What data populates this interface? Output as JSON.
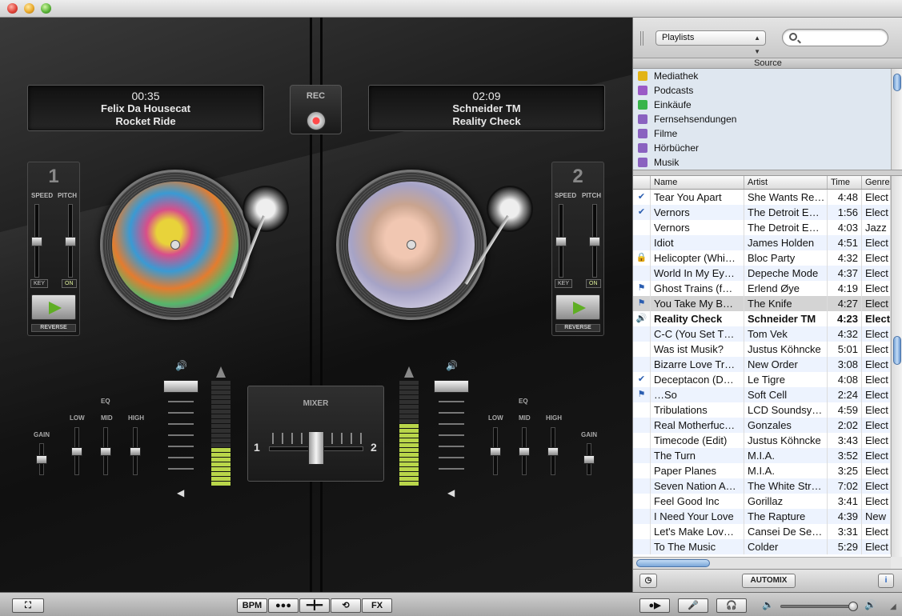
{
  "deck_left": {
    "time": "00:35",
    "artist": "Felix Da Housecat",
    "song": "Rocket Ride",
    "number": "1"
  },
  "deck_right": {
    "time": "02:09",
    "artist": "Schneider TM",
    "song": "Reality Check",
    "number": "2"
  },
  "rec_label": "REC",
  "deck_controls": {
    "speed": "SPEED",
    "pitch": "PITCH",
    "key": "KEY",
    "on": "ON",
    "reverse": "REVERSE"
  },
  "eq": {
    "title": "EQ",
    "low": "LOW",
    "mid": "MID",
    "high": "HIGH",
    "gain": "GAIN"
  },
  "mixer": {
    "label": "MIXER",
    "left": "1",
    "right": "2"
  },
  "sidebar": {
    "playlist_select": "Playlists",
    "search_placeholder": "",
    "source_header": "Source",
    "sources": [
      {
        "label": "Mediathek",
        "icon": "music-library-icon",
        "color": "#e2b418"
      },
      {
        "label": "Podcasts",
        "icon": "podcast-icon",
        "color": "#9b59c6"
      },
      {
        "label": "Einkäufe",
        "icon": "store-icon",
        "color": "#38b44a"
      },
      {
        "label": "Fernsehsendungen",
        "icon": "smart-playlist-icon",
        "color": "#8a62c0"
      },
      {
        "label": "Filme",
        "icon": "smart-playlist-icon",
        "color": "#8a62c0"
      },
      {
        "label": "Hörbücher",
        "icon": "smart-playlist-icon",
        "color": "#8a62c0"
      },
      {
        "label": "Musik",
        "icon": "smart-playlist-icon",
        "color": "#8a62c0"
      }
    ]
  },
  "tracklist": {
    "columns": [
      "Name",
      "Artist",
      "Time",
      "Genre"
    ],
    "rows": [
      {
        "mark": "✔",
        "name": "Tear You Apart",
        "artist": "She Wants Re…",
        "time": "4:48",
        "genre": "Elect"
      },
      {
        "mark": "✔",
        "name": "Vernors",
        "artist": "The Detroit E…",
        "time": "1:56",
        "genre": "Elect"
      },
      {
        "mark": "",
        "name": "Vernors",
        "artist": "The Detroit E…",
        "time": "4:03",
        "genre": "Jazz"
      },
      {
        "mark": "",
        "name": "Idiot",
        "artist": "James Holden",
        "time": "4:51",
        "genre": "Elect"
      },
      {
        "mark": "🔒",
        "name": "Helicopter (Whi…",
        "artist": "Bloc Party",
        "time": "4:32",
        "genre": "Elect"
      },
      {
        "mark": "",
        "name": "World In My Ey…",
        "artist": "Depeche Mode",
        "time": "4:37",
        "genre": "Elect"
      },
      {
        "mark": "⚑",
        "name": "Ghost Trains (f…",
        "artist": "Erlend Øye",
        "time": "4:19",
        "genre": "Elect"
      },
      {
        "mark": "⚑",
        "name": "You Take My B…",
        "artist": "The Knife",
        "time": "4:27",
        "genre": "Elect"
      },
      {
        "mark": "🔊",
        "name": "Reality Check",
        "artist": "Schneider TM",
        "time": "4:23",
        "genre": "Elect"
      },
      {
        "mark": "",
        "name": "C-C (You Set T…",
        "artist": "Tom Vek",
        "time": "4:32",
        "genre": "Elect"
      },
      {
        "mark": "",
        "name": "Was ist Musik?",
        "artist": "Justus Köhncke",
        "time": "5:01",
        "genre": "Elect"
      },
      {
        "mark": "",
        "name": "Bizarre Love Tr…",
        "artist": "New Order",
        "time": "3:08",
        "genre": "Elect"
      },
      {
        "mark": "✔",
        "name": "Deceptacon (D…",
        "artist": "Le Tigre",
        "time": "4:08",
        "genre": "Elect"
      },
      {
        "mark": "⚑",
        "name": "…So",
        "artist": "Soft Cell",
        "time": "2:24",
        "genre": "Elect"
      },
      {
        "mark": "",
        "name": "Tribulations",
        "artist": "LCD Soundsy…",
        "time": "4:59",
        "genre": "Elect"
      },
      {
        "mark": "",
        "name": "Real Motherfuc…",
        "artist": "Gonzales",
        "time": "2:02",
        "genre": "Elect"
      },
      {
        "mark": "",
        "name": "Timecode (Edit)",
        "artist": "Justus Köhncke",
        "time": "3:43",
        "genre": "Elect"
      },
      {
        "mark": "",
        "name": "The Turn",
        "artist": "M.I.A.",
        "time": "3:52",
        "genre": "Elect"
      },
      {
        "mark": "",
        "name": "Paper Planes",
        "artist": "M.I.A.",
        "time": "3:25",
        "genre": "Elect"
      },
      {
        "mark": "",
        "name": "Seven Nation A…",
        "artist": "The White Str…",
        "time": "7:02",
        "genre": "Elect"
      },
      {
        "mark": "",
        "name": "Feel Good Inc",
        "artist": "Gorillaz",
        "time": "3:41",
        "genre": "Elect"
      },
      {
        "mark": "",
        "name": "I Need Your Love",
        "artist": "The Rapture",
        "time": "4:39",
        "genre": "New"
      },
      {
        "mark": "",
        "name": "Let's Make Lov…",
        "artist": "Cansei De Se…",
        "time": "3:31",
        "genre": "Elect"
      },
      {
        "mark": "",
        "name": "To The Music",
        "artist": "Colder",
        "time": "5:29",
        "genre": "Elect"
      }
    ]
  },
  "panel_bottom": {
    "automix": "AUTOMIX",
    "info": "i"
  },
  "toolbar": {
    "bpm": "BPM",
    "fx": "FX"
  },
  "colors": {
    "meter_lit": "#b9d64a",
    "rec_red": "#ff4a4a"
  }
}
